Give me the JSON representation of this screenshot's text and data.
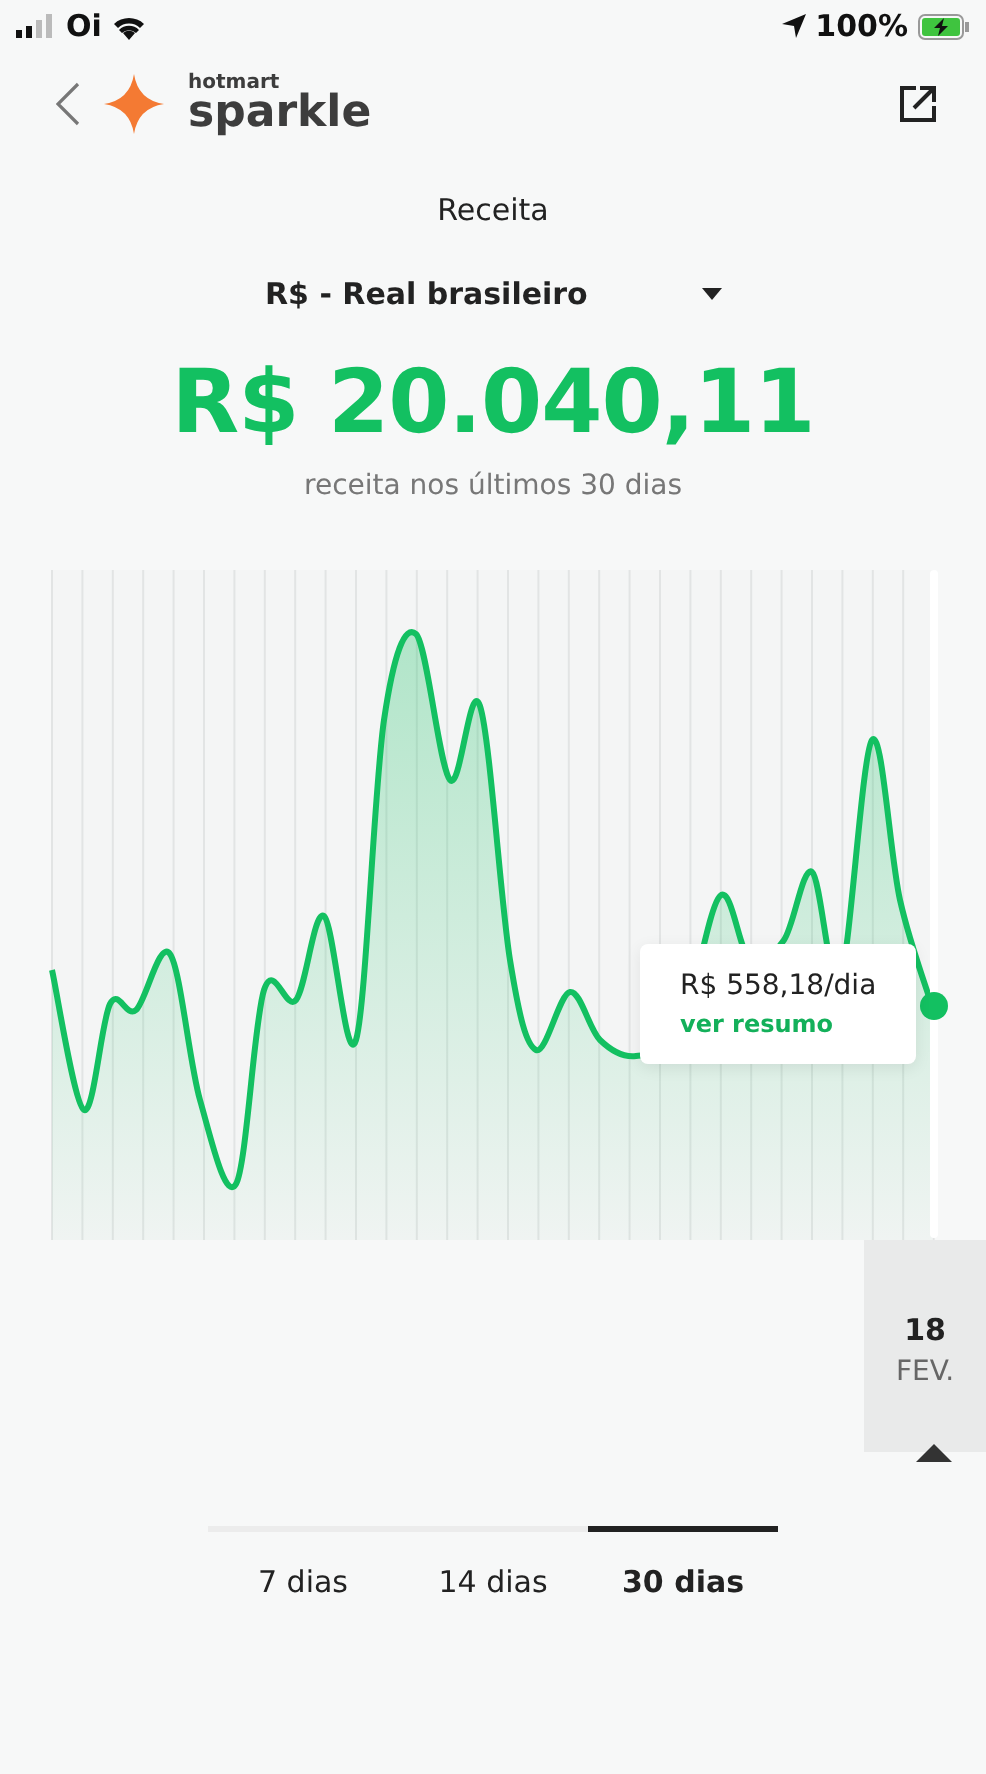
{
  "status_bar": {
    "carrier": "Oi",
    "battery": "100%"
  },
  "header": {
    "brand_small": "hotmart",
    "brand_name": "sparkle"
  },
  "title": "Receita",
  "currency_select": {
    "value": "R$ - Real brasileiro"
  },
  "total": {
    "amount": "R$ 20.040,11",
    "caption": "receita nos últimos 30 dias"
  },
  "chart": {
    "tooltip": {
      "value": "R$ 558,18/dia",
      "link": "ver resumo"
    },
    "date": {
      "day": "18",
      "month": "FEV."
    }
  },
  "tabs": [
    {
      "label": "7 dias",
      "selected": false
    },
    {
      "label": "14 dias",
      "selected": false
    },
    {
      "label": "30 dias",
      "selected": true
    }
  ]
}
